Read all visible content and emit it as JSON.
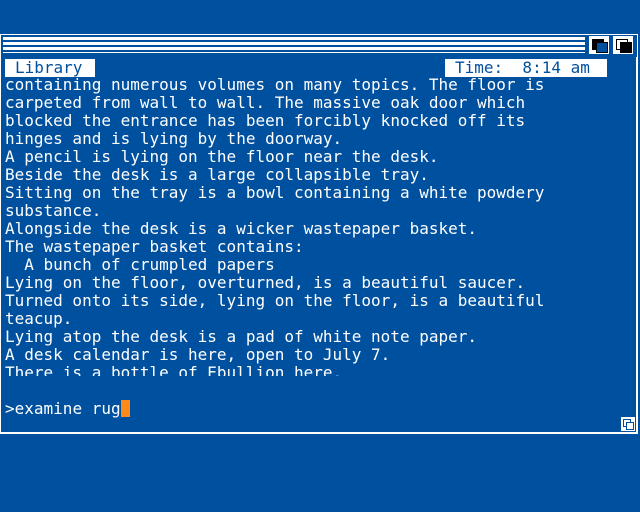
{
  "status": {
    "location": "Library",
    "time_label": "Time:  8:14 am"
  },
  "text_lines": [
    "containing numerous volumes on many topics. The floor is",
    "carpeted from wall to wall. The massive oak door which",
    "blocked the entrance has been forcibly knocked off its",
    "hinges and is lying by the doorway.",
    "A pencil is lying on the floor near the desk.",
    "Beside the desk is a large collapsible tray.",
    "Sitting on the tray is a bowl containing a white powdery",
    "substance.",
    "Alongside the desk is a wicker wastepaper basket.",
    "The wastepaper basket contains:",
    "  A bunch of crumpled papers",
    "Lying on the floor, overturned, is a beautiful saucer.",
    "Turned onto its side, lying on the floor, is a beautiful",
    "teacup.",
    "Lying atop the desk is a pad of white note paper.",
    "A desk calendar is here, open to July 7.",
    "There is a bottle of Ebullion here."
  ],
  "prompt": {
    "symbol": ">",
    "input": "examine rug"
  },
  "colors": {
    "background": "#0050a0",
    "foreground": "#ffffff",
    "cursor": "#ff8a1a"
  }
}
